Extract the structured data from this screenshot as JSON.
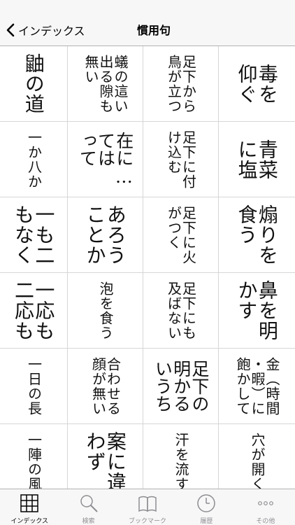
{
  "navbar": {
    "back_label": "インデックス",
    "title": "慣用句"
  },
  "grid_cells": [
    "鼬の道",
    "蟻の這い\n出る隙も\n無い",
    "足下から\n鳥が立つ",
    "毒を\n仰ぐ",
    "一か八か",
    "在に…\nては\nって",
    "足下に付\nけ込む",
    "青菜\nに塩",
    "一も二\nもなく",
    "あろう\nことか",
    "足下に火\nがつく",
    "煽りを\n食う",
    "一応も\n二応も",
    "泡を食う",
    "足下にも\n及ばない",
    "鼻を明\nかす",
    "一日の長",
    "合わせる\n顔が無い",
    "足下の\n明かる\nいうち",
    "金（時間\n・暇）に\n飽かして",
    "一陣の風",
    "案に違\nわず",
    "汗を流す",
    "穴が開く"
  ],
  "tabs": [
    {
      "label": "インデックス",
      "icon": "grid-icon",
      "active": true
    },
    {
      "label": "検索",
      "icon": "search-icon",
      "active": false
    },
    {
      "label": "ブックマーク",
      "icon": "book-icon",
      "active": false
    },
    {
      "label": "履歴",
      "icon": "clock-icon",
      "active": false
    },
    {
      "label": "その他",
      "icon": "more-icon",
      "active": false
    }
  ],
  "colors": {
    "bar_background": "#f7f7f7",
    "active_tab": "#000000",
    "inactive_tab": "#8e8e93",
    "grid_line": "#d6d6d6"
  }
}
